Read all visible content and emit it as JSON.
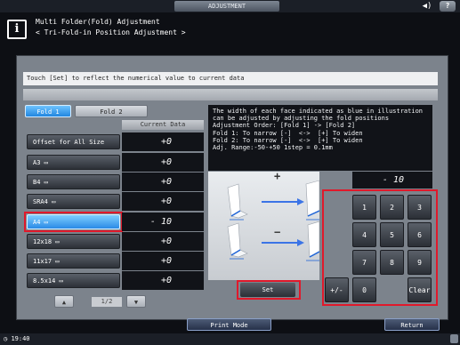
{
  "topbar": {
    "title": "ADJUSTMENT",
    "speaker_icon": "speaker-icon",
    "help_label": "?"
  },
  "header": {
    "line1": "Multi Folder(Fold) Adjustment",
    "line2": "< Tri-Fold-in Position Adjustment >",
    "icon": "info-icon"
  },
  "instruction": "Touch [Set] to reflect the numerical value to current data",
  "tabs": [
    {
      "label": "Fold 1",
      "active": true
    },
    {
      "label": "Fold 2",
      "active": false
    }
  ],
  "current_data_header": "Current Data",
  "rows": [
    {
      "label": "Offset for All Size",
      "value": "+0"
    },
    {
      "label": "A3",
      "value": "+0"
    },
    {
      "label": "B4",
      "value": "+0"
    },
    {
      "label": "SRA4",
      "value": "+0"
    },
    {
      "label": "A4",
      "value": "- 10",
      "selected": true
    },
    {
      "label": "12x18",
      "value": "+0"
    },
    {
      "label": "11x17",
      "value": "+0"
    },
    {
      "label": "8.5x14",
      "value": "+0"
    }
  ],
  "pager": {
    "text": "1/2",
    "up": "▲",
    "down": "▼"
  },
  "description": {
    "lines": [
      "The width of each face indicated as blue in illustration",
      "can be adjusted by adjusting the fold positions",
      "Adjustment Order: [Fold 1] -> [Fold 2]",
      "Fold 1: To narrow [-]  <->  [+] To widen",
      "Fold 2: To narrow [-]  <->  [+] To widen",
      "",
      "Adj. Range:-50-+50 1step = 0.1mm"
    ]
  },
  "illustration": {
    "plus": "+",
    "minus": "−"
  },
  "input_value": "- 10",
  "keypad": {
    "keys": [
      "1",
      "2",
      "3",
      "4",
      "5",
      "6",
      "7",
      "8",
      "9",
      "+/-",
      "0",
      "Clear"
    ]
  },
  "set_label": "Set",
  "footer": {
    "print_mode": "Print Mode",
    "return": "Return",
    "clock": "19:40"
  },
  "colors": {
    "accent_blue": "#2a8ae6",
    "highlight_red": "#e0192b",
    "panel": "#7c838c"
  }
}
